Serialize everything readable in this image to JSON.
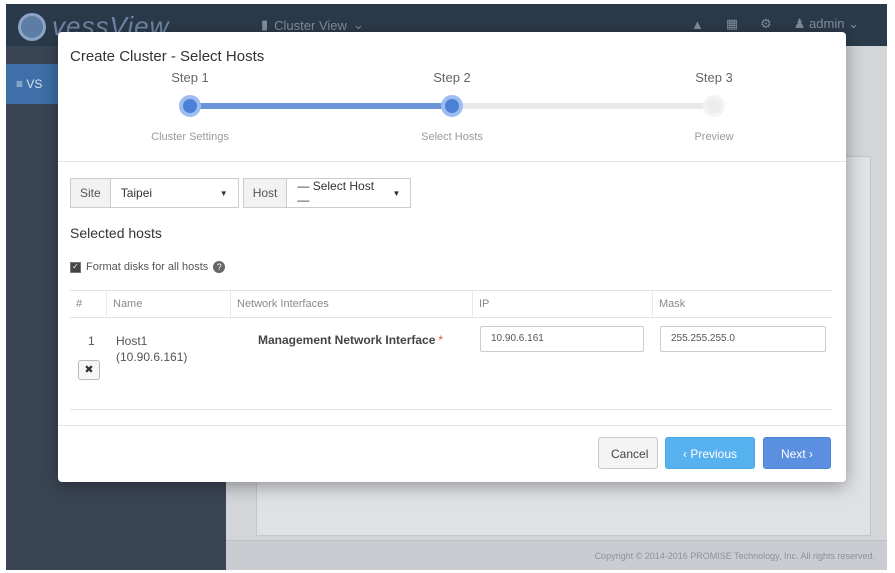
{
  "app": {
    "brand": "vessView",
    "nav_label": "Cluster View",
    "user": "admin",
    "sidebar_active": "VS",
    "footer_text": "Copyright © 2014-2016 PROMISE Technology, Inc. All rights reserved."
  },
  "modal": {
    "title": "Create Cluster - Select Hosts",
    "steps": [
      {
        "label": "Step 1",
        "caption": "Cluster Settings",
        "state": "done"
      },
      {
        "label": "Step 2",
        "caption": "Select Hosts",
        "state": "active"
      },
      {
        "label": "Step 3",
        "caption": "Preview",
        "state": "todo"
      }
    ],
    "filters": {
      "site_label": "Site",
      "site_value": "Taipei",
      "host_label": "Host",
      "host_value": "— Select Host —"
    },
    "selected_hosts_title": "Selected hosts",
    "format_disks_label": "Format disks for all hosts",
    "format_disks_checked": true,
    "table": {
      "columns": [
        "#",
        "Name",
        "Network Interfaces",
        "IP",
        "Mask"
      ],
      "rows": [
        {
          "index": "1",
          "name": "Host1",
          "address": "(10.90.6.161)",
          "interface": "Management Network Interface",
          "required_mark": "*",
          "ip": "10.90.6.161",
          "mask": "255.255.255.0"
        }
      ]
    },
    "buttons": {
      "cancel": "Cancel",
      "previous": "‹ Previous",
      "next": "Next ›"
    }
  },
  "colors": {
    "accent": "#4a80d6",
    "previous_button": "#58b1ef",
    "next_button": "#5b8fe0",
    "required": "#d9534f"
  }
}
